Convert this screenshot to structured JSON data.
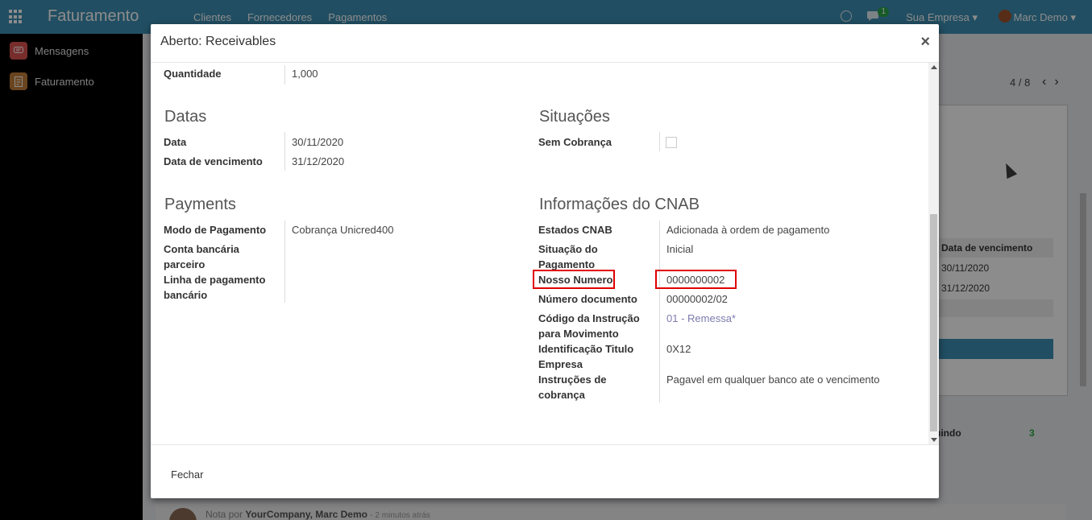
{
  "navbar": {
    "app_title": "Faturamento",
    "menu": [
      "Clientes",
      "Fornecedores",
      "Pagamentos"
    ],
    "message_count": "1",
    "company": "Sua Empresa ▾",
    "user": "Marc Demo ▾"
  },
  "sidebar": {
    "items": [
      {
        "label": "Mensagens",
        "icon": "chat-icon",
        "color": "#d9534f"
      },
      {
        "label": "Faturamento",
        "icon": "invoice-icon",
        "color": "#c27c3a"
      }
    ]
  },
  "background": {
    "pager": "4 / 8",
    "table_header": "Data de vencimento",
    "table_rows": [
      "30/11/2020",
      "31/12/2020"
    ],
    "following": "uindo",
    "followers": "3",
    "note_prefix": "Nota por",
    "note_author": "YourCompany, Marc Demo",
    "note_time": "- 2 minutos atrás"
  },
  "modal": {
    "title": "Aberto: Receivables",
    "close_symbol": "×",
    "footer_button": "Fechar",
    "top_field": {
      "label": "Quantidade",
      "value": "1,000"
    },
    "datas": {
      "title": "Datas",
      "fields": [
        {
          "label": "Data",
          "value": "30/11/2020"
        },
        {
          "label": "Data de vencimento",
          "value": "31/12/2020"
        }
      ]
    },
    "situacoes": {
      "title": "Situações",
      "fields": [
        {
          "label": "Sem Cobrança",
          "checked": false
        }
      ]
    },
    "payments": {
      "title": "Payments",
      "fields": [
        {
          "label": "Modo de Pagamento",
          "value": "Cobrança Unicred400"
        },
        {
          "label": "Conta bancária parceiro",
          "value": ""
        },
        {
          "label": "Linha de pagamento bancário",
          "value": ""
        }
      ]
    },
    "cnab": {
      "title": "Informações do CNAB",
      "fields": [
        {
          "label": "Estados CNAB",
          "value": "Adicionada à ordem de pagamento"
        },
        {
          "label": "Situação do Pagamento",
          "value": "Inicial"
        },
        {
          "label": "Nosso Numero",
          "value": "0000000002"
        },
        {
          "label": "Número documento",
          "value": "00000002/02"
        },
        {
          "label": "Código da Instrução para Movimento",
          "value": "01 - Remessa*"
        },
        {
          "label": "Identificação Titulo Empresa",
          "value": "0X12"
        },
        {
          "label": "Instruções de cobrança",
          "value": "Pagavel em qualquer banco ate o vencimento"
        }
      ]
    }
  },
  "colors": {
    "navbar": "#3d8fb2",
    "highlight": "#e00000",
    "link": "#7c7bad"
  }
}
